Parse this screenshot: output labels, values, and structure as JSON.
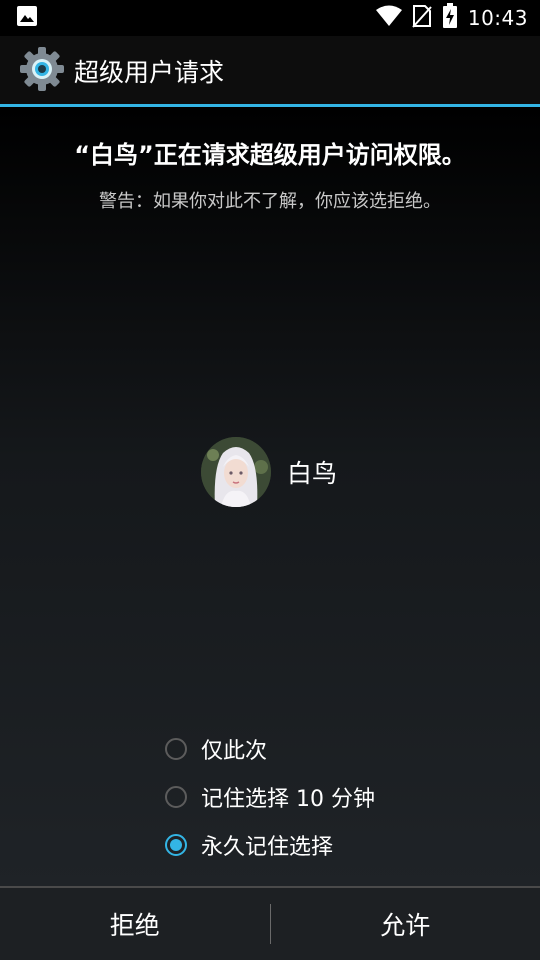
{
  "status_bar": {
    "time": "10:43",
    "icons": [
      "image-notification-icon",
      "wifi-icon",
      "no-sim-icon",
      "battery-charging-icon"
    ]
  },
  "appbar": {
    "icon": "gear-icon",
    "title": "超级用户请求"
  },
  "request": {
    "headline": "“白鸟”正在请求超级用户访问权限。",
    "warning": "警告：如果你对此不了解，你应该选拒绝。"
  },
  "app": {
    "name": "白鸟",
    "avatar_icon": "app-avatar"
  },
  "options": [
    {
      "label": "仅此次",
      "checked": false
    },
    {
      "label": "记住选择 10 分钟",
      "checked": false
    },
    {
      "label": "永久记住选择",
      "checked": true
    }
  ],
  "buttons": {
    "deny": "拒绝",
    "allow": "允许"
  },
  "colors": {
    "accent": "#33b5e5",
    "background_top": "#000000",
    "background_bottom": "#1f2327",
    "button_bar": "#1d2023"
  }
}
